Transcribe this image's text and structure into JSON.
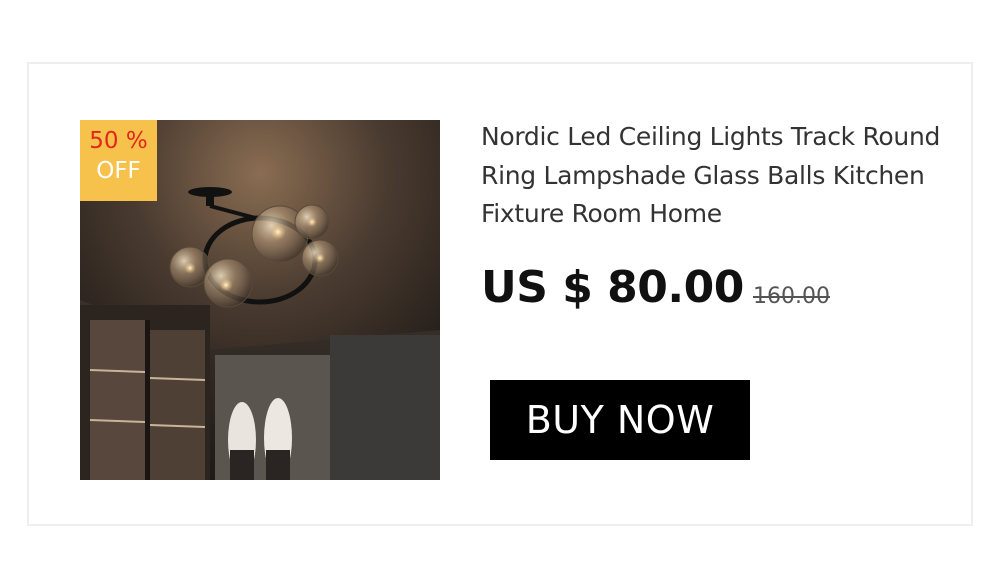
{
  "product": {
    "title": "Nordic Led Ceiling Lights Track Round Ring Lampshade Glass Balls Kitchen Fixture Room Home",
    "image_desc": "ceiling light with glass balls",
    "discount": {
      "line1": "50 %",
      "line2": "OFF"
    },
    "price": {
      "current": "US $ 80.00",
      "original": "160.00"
    },
    "buy_label": "BUY NOW"
  },
  "colors": {
    "badge_bg": "#f6c24c",
    "badge_text": "#e0281d",
    "button_bg": "#000000",
    "button_text": "#ffffff",
    "title_text": "#333333"
  }
}
